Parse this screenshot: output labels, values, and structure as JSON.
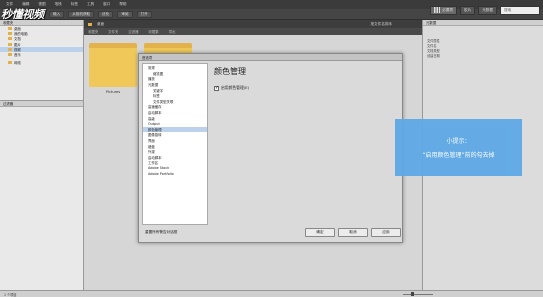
{
  "logo": {
    "text": "秒懂视频"
  },
  "menubar": {
    "items": [
      "文件",
      "编辑",
      "视图",
      "堆栈",
      "标签",
      "工具",
      "窗口",
      "帮助"
    ]
  },
  "toolbar": {
    "items": [
      "输入",
      "从相机获取",
      "优化",
      "审阅",
      "打开"
    ]
  },
  "right_tools": {
    "essentials": "必要项",
    "filmstrip": "胶片",
    "metadata": "元数据",
    "search_placeholder": "搜索"
  },
  "pathbar": {
    "crumbs": [
      "桌面"
    ],
    "sort": "按文件名排序"
  },
  "filterbar": {
    "tabs": [
      "收藏夹",
      "文件夹",
      "过滤器",
      "收藏集",
      "导出"
    ]
  },
  "left_panel": {
    "header": "收藏夹",
    "items": [
      {
        "label": "桌面",
        "selected": false
      },
      {
        "label": "我的电脑",
        "selected": false
      },
      {
        "label": "文档",
        "selected": false
      },
      {
        "label": "图片",
        "selected": false
      },
      {
        "label": "视频",
        "selected": true
      },
      {
        "label": "音乐",
        "selected": false
      }
    ],
    "extra": "网络"
  },
  "left_panel2": {
    "header": "过滤器"
  },
  "content": {
    "folders": [
      {
        "label": "Pictures"
      },
      {
        "label": ""
      }
    ]
  },
  "right_panel": {
    "header": "元数据",
    "meta": [
      "文件属性",
      "文件名",
      "文档类型",
      "创建日期"
    ]
  },
  "statusbar": {
    "text": "1 个项目"
  },
  "dialog": {
    "title": "首选项",
    "list": [
      {
        "label": "常规",
        "sub": false
      },
      {
        "label": "缩览图",
        "sub": true
      },
      {
        "label": "播放",
        "sub": false
      },
      {
        "label": "元数据",
        "sub": false
      },
      {
        "label": "关键字",
        "sub": false
      },
      {
        "label": "标签",
        "sub": false
      },
      {
        "label": "文件类型关联",
        "sub": false
      },
      {
        "label": "高速缓存",
        "sub": false
      },
      {
        "label": "启动脚本",
        "sub": false
      },
      {
        "label": "高级",
        "sub": false
      },
      {
        "label": "Output",
        "sub": false
      },
      {
        "label": "颜色管理",
        "sub": false
      },
      {
        "label": "图像旋转",
        "sub": false
      },
      {
        "label": "界面",
        "sub": false
      },
      {
        "label": "键盘",
        "sub": false
      },
      {
        "label": "外观",
        "sub": false
      },
      {
        "label": "启动脚本",
        "sub": false
      },
      {
        "label": "工作区",
        "sub": false
      },
      {
        "label": "Adobe Stock",
        "sub": false
      },
      {
        "label": "Adobe Portfolio",
        "sub": false
      }
    ],
    "heading": "颜色管理",
    "checkbox_label": "启用颜色管理(E)",
    "checkbox_checked": true,
    "restore_label": "重置所有警告对话框",
    "buttons": {
      "ok": "确定",
      "cancel": "取消",
      "apply": "应用"
    }
  },
  "tip": {
    "title": "小提示：",
    "body": "“启用颜色管理”前的勾去掉"
  }
}
